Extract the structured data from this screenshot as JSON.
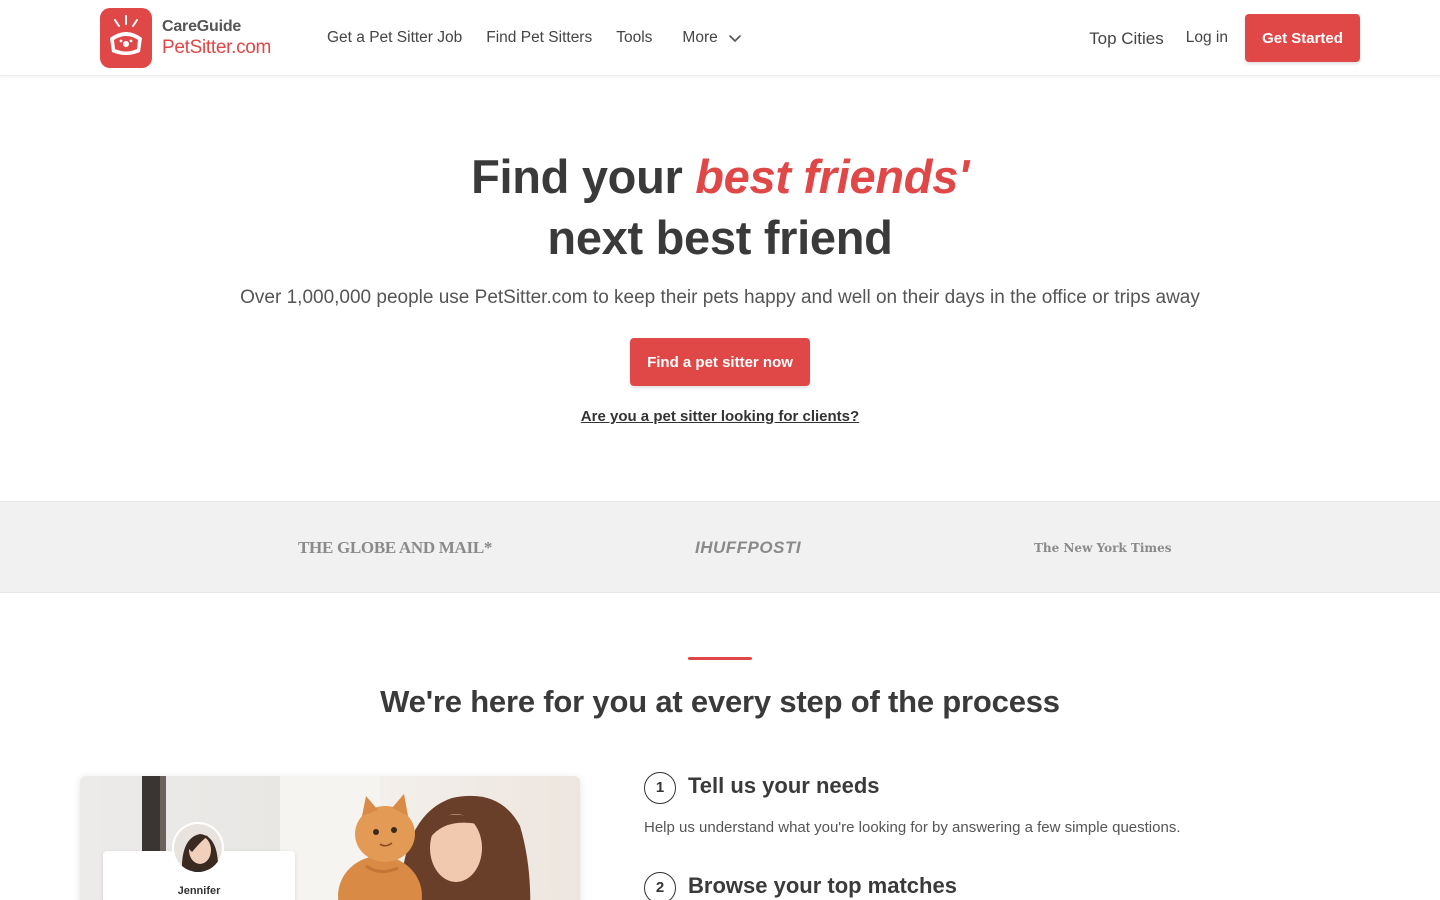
{
  "brand": {
    "top": "CareGuide",
    "bottom": "PetSitter.com",
    "accent_color": "#e04747"
  },
  "nav": {
    "items": [
      "Get a Pet Sitter Job",
      "Find Pet Sitters",
      "Tools"
    ],
    "more_label": "More"
  },
  "header_right": {
    "top_cities": "Top Cities",
    "login": "Log in",
    "get_started": "Get Started"
  },
  "hero": {
    "title_prefix": "Find your ",
    "title_accent": "best friends'",
    "title_line2": "next best friend",
    "subtitle": "Over 1,000,000 people use PetSitter.com to keep their pets happy and well on their days in the office or trips away",
    "cta": "Find a pet sitter now",
    "sitter_link": "Are you a pet sitter looking for clients?"
  },
  "press": {
    "logos": [
      "THE GLOBE AND MAIL*",
      "IHUFFPOSTI",
      "The New York Times"
    ]
  },
  "process": {
    "title": "We're here for you at every step of the process",
    "profile_name": "Jennifer",
    "steps": [
      {
        "number": "1",
        "title": "Tell us your needs",
        "desc": "Help us understand what you're looking for by answering a few simple questions."
      },
      {
        "number": "2",
        "title": "Browse your top matches",
        "desc": ""
      }
    ]
  }
}
